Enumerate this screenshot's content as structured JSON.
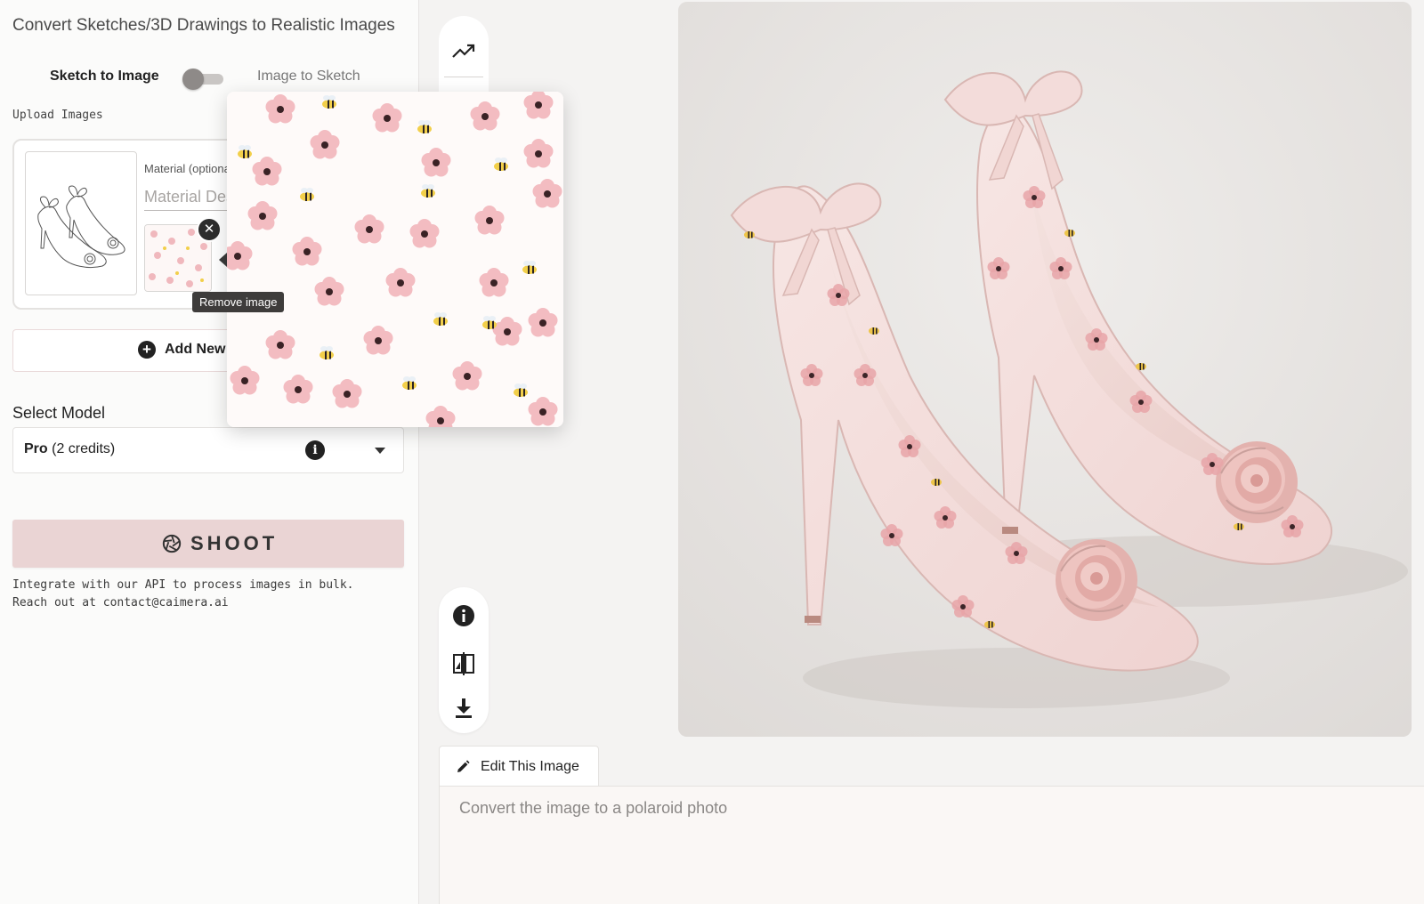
{
  "app": {
    "title": "Convert Sketches/3D Drawings to Realistic Images"
  },
  "mode_toggle": {
    "left_label": "Sketch to Image",
    "right_label": "Image to Sketch",
    "state": "Sketch to Image"
  },
  "upload": {
    "section_label": "Upload Images",
    "material_label": "Material (optional)",
    "material_placeholder": "Material Description",
    "remove_tooltip": "Remove image",
    "add_new_label": "Add New"
  },
  "model": {
    "label": "Select Model",
    "selected_name": "Pro",
    "selected_detail": "(2 credits)"
  },
  "shoot": {
    "label": "SHOOT"
  },
  "api_note": "Integrate with our API to process images in bulk.\nReach out at contact@caimera.ai",
  "tool_rail": {
    "top": [
      "trending-up-icon",
      "face-icon"
    ],
    "bottom": [
      "info-icon",
      "compare-icon",
      "download-icon"
    ]
  },
  "editor": {
    "tab_label": "Edit This Image",
    "placeholder": "Convert the image to a polaroid photo"
  },
  "colors": {
    "shoot_bg": "#ead4d4",
    "panel_bg": "#fbfbfa",
    "canvas_bg": "#f4f3f2",
    "flower": "#f0b8bd",
    "bee": "#f2cf4a"
  }
}
